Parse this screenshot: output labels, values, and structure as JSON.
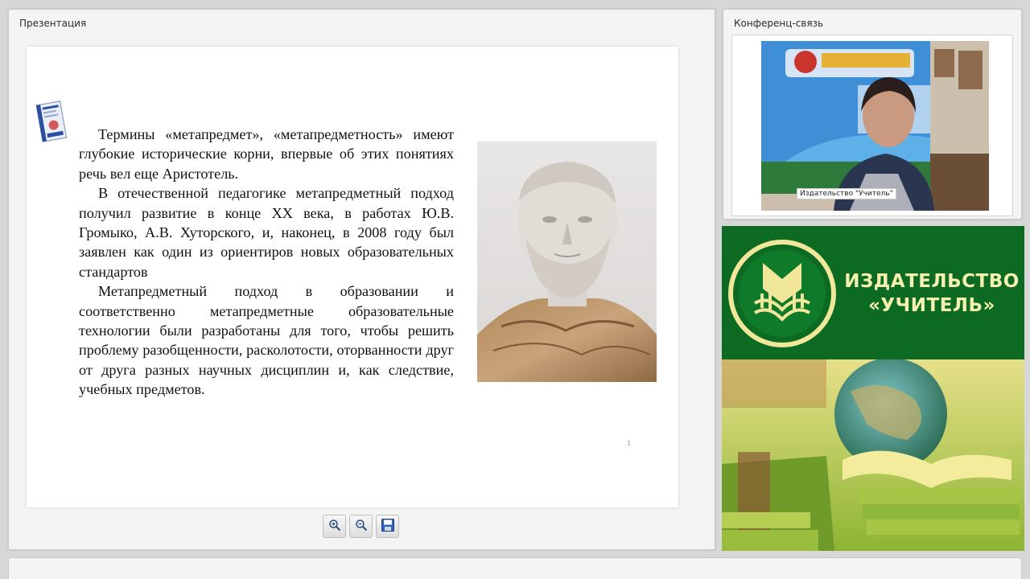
{
  "presentation": {
    "title": "Презентация",
    "slide": {
      "paragraphs": [
        "Термины «метапредмет», «метапредметность» имеют глубокие исторические корни, впервые об этих понятиях речь вел еще Аристотель.",
        "В отечественной педагогике метапредметный подход получил развитие в конце XX века, в работах Ю.В. Громыко, А.В. Хуторского, и, наконец, в 2008 году был заявлен как один из ориентиров новых образовательных стандартов",
        "Метапредметный подход в образовании и соответственно метапредметные образовательные технологии были разработаны для того, чтобы решить проблему разобщенности, расколотости, оторванности друг от друга разных научных дисциплин и, как следствие, учебных предметов."
      ],
      "page_marker": "1"
    },
    "toolbar": [
      "zoom-in-icon",
      "zoom-out-icon",
      "save-icon"
    ]
  },
  "conference": {
    "title": "Конференц-связь",
    "video_caption": "Издательство \"Учитель\""
  },
  "banner": {
    "line1": "ИЗДАТЕЛЬСТВО",
    "line2": "«УЧИТЕЛЬ»"
  },
  "colors": {
    "banner_green": "#0c6a22",
    "banner_text": "#f5f0b0"
  }
}
